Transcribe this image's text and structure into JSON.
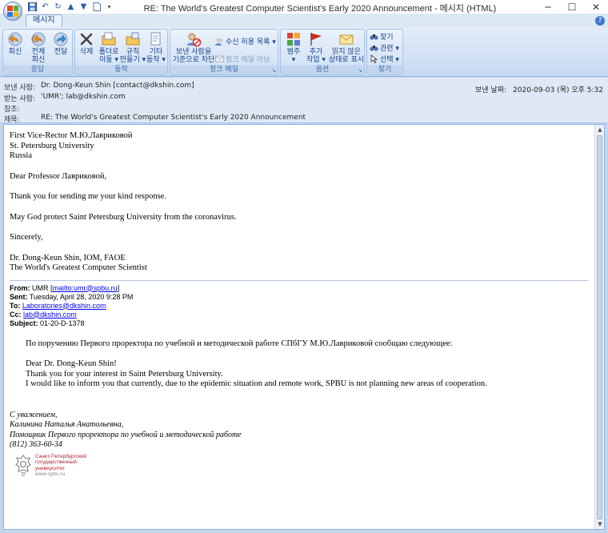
{
  "window": {
    "title": "RE: The World's Greatest Computer Scientist's Early 2020 Announcement - 메시지 (HTML)"
  },
  "ribbon": {
    "tab": "메시지",
    "groups": {
      "respond": {
        "label": "응답",
        "reply": "회신",
        "reply_all_1": "전체",
        "reply_all_2": "회신",
        "forward": "전달"
      },
      "actions": {
        "label": "동작",
        "delete": "삭제",
        "move_1": "폴더로",
        "move_2": "이동 ▾",
        "rules_1": "규칙",
        "rules_2": "만들기 ▾",
        "other_1": "기타",
        "other_2": "동작 ▾"
      },
      "junk": {
        "label": "정크 메일",
        "block_1": "보낸 사람을",
        "block_2": "기준으로 차단",
        "safe_list": "수신 허용 목록 ▾",
        "not_junk": "정크 메일 아님"
      },
      "options": {
        "label": "옵션",
        "categorize_1": "범주",
        "categorize_2": "▾",
        "followup_1": "추가",
        "followup_2": "작업 ▾",
        "unread_1": "읽지 않은",
        "unread_2": "상태로 표시"
      },
      "find": {
        "label": "찾기",
        "find": "찾기",
        "related": "관련 ▾",
        "select": "선택 ▾"
      }
    }
  },
  "headers": {
    "from_label": "보낸 사람:",
    "from_value": "Dr. Dong-Keun Shin [contact@dkshin.com]",
    "to_label": "받는 사람:",
    "to_value": "'UMR'; lab@dkshin.com",
    "cc_label": "참조:",
    "subject_label": "제목:",
    "subject_value": "RE: The World's Greatest Computer Scientist's Early 2020 Announcement",
    "sent_label": "보낸 날짜:",
    "sent_value": "2020-09-03 (목) 오후 5:32"
  },
  "body": {
    "addr1": "First Vice-Rector М.Ю.Лавриковой",
    "addr2": "St. Petersburg University",
    "addr3": "Russia",
    "greeting": "Dear Professor Лавриковой,",
    "p1": "Thank you for sending me your kind response.",
    "p2": "May God protect Saint Petersburg University from the coronavirus.",
    "closing": "Sincerely,",
    "sig1": "Dr. Dong-Keun Shin, IOM, FAOE",
    "sig2": "The World's Greatest Computer Scientist"
  },
  "forwarded": {
    "from_label": "From:",
    "from_name": "UMR [",
    "from_link": "mailto:umr@spbu.ru",
    "from_end": "]",
    "sent_label": "Sent:",
    "sent_value": "Tuesday, April 28, 2020 9:28 PM",
    "to_label": "To:",
    "to_link": "Laboratories@dkshin.com",
    "cc_label": "Cc:",
    "cc_link": "lab@dkshin.com",
    "subject_label": "Subject:",
    "subject_value": "01-20-D-1378",
    "intro": "По поручению Первого проректора по учебной и методической работе СПбГУ М.Ю.Лавриковой сообщаю следующее:",
    "dear": "Dear Dr. Dong-Keun Shin!",
    "thanks": "Thank you for your interest in Saint Petersburg University.",
    "inform": "I would like to inform you that currently, due to the epidemic situation and remote work, SPBU is not planning new areas of cooperation.",
    "regards": "С уважением,",
    "name": "Калинина Наталья Анатольевна,",
    "position": "Помощник  Первого проректора по учебной и методической работе",
    "phone": "(812) 363-60-34",
    "logo_line1": "Санкт-Петербургский",
    "logo_line2": "государственный",
    "logo_line3": "университет",
    "logo_url": "www.spbu.ru"
  }
}
